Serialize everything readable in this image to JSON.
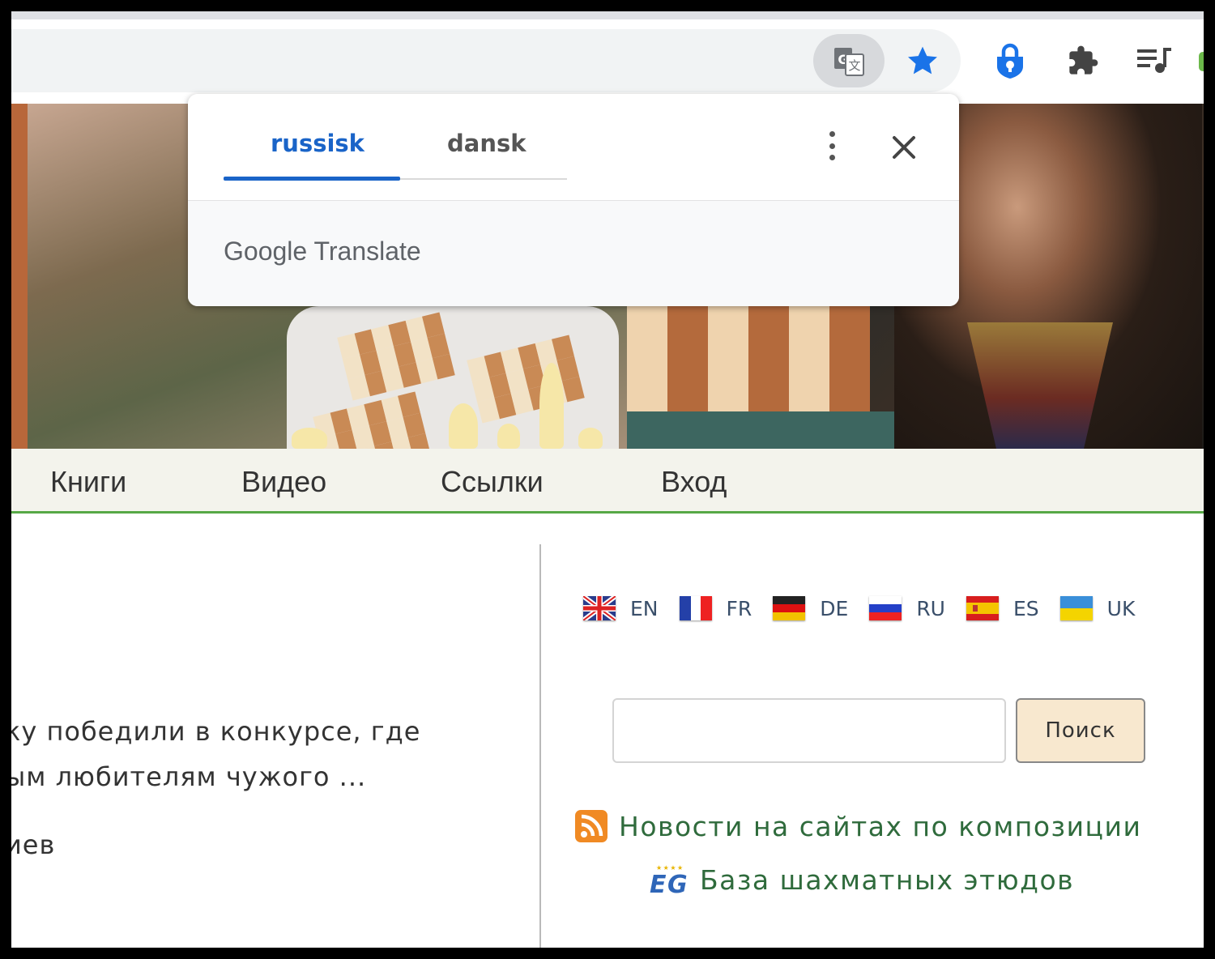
{
  "translate_popup": {
    "tabs": [
      {
        "label": "russisk",
        "active": true
      },
      {
        "label": "dansk",
        "active": false
      }
    ],
    "brand_google": "Google",
    "brand_translate": "Translate"
  },
  "toolbar": {
    "icons": [
      "translate-icon",
      "bookmark-star-icon",
      "password-lock-icon",
      "extensions-puzzle-icon",
      "media-queue-icon"
    ],
    "accent": "#1a73e8"
  },
  "nav": {
    "items": [
      "Книги",
      "Видео",
      "Ссылки",
      "Вход"
    ]
  },
  "excerpt": {
    "line1": "ку победили в конкурсе, где",
    "line2": "ым любителям чужого ...",
    "line3": "иев"
  },
  "languages": [
    {
      "code": "EN"
    },
    {
      "code": "FR"
    },
    {
      "code": "DE"
    },
    {
      "code": "RU"
    },
    {
      "code": "ES"
    },
    {
      "code": "UK"
    }
  ],
  "search": {
    "value": "",
    "button_label": "Поиск"
  },
  "links": {
    "news": "Новости на сайтах по композиции",
    "eg_logo": "EG",
    "studies": "База шахматных этюдов"
  }
}
